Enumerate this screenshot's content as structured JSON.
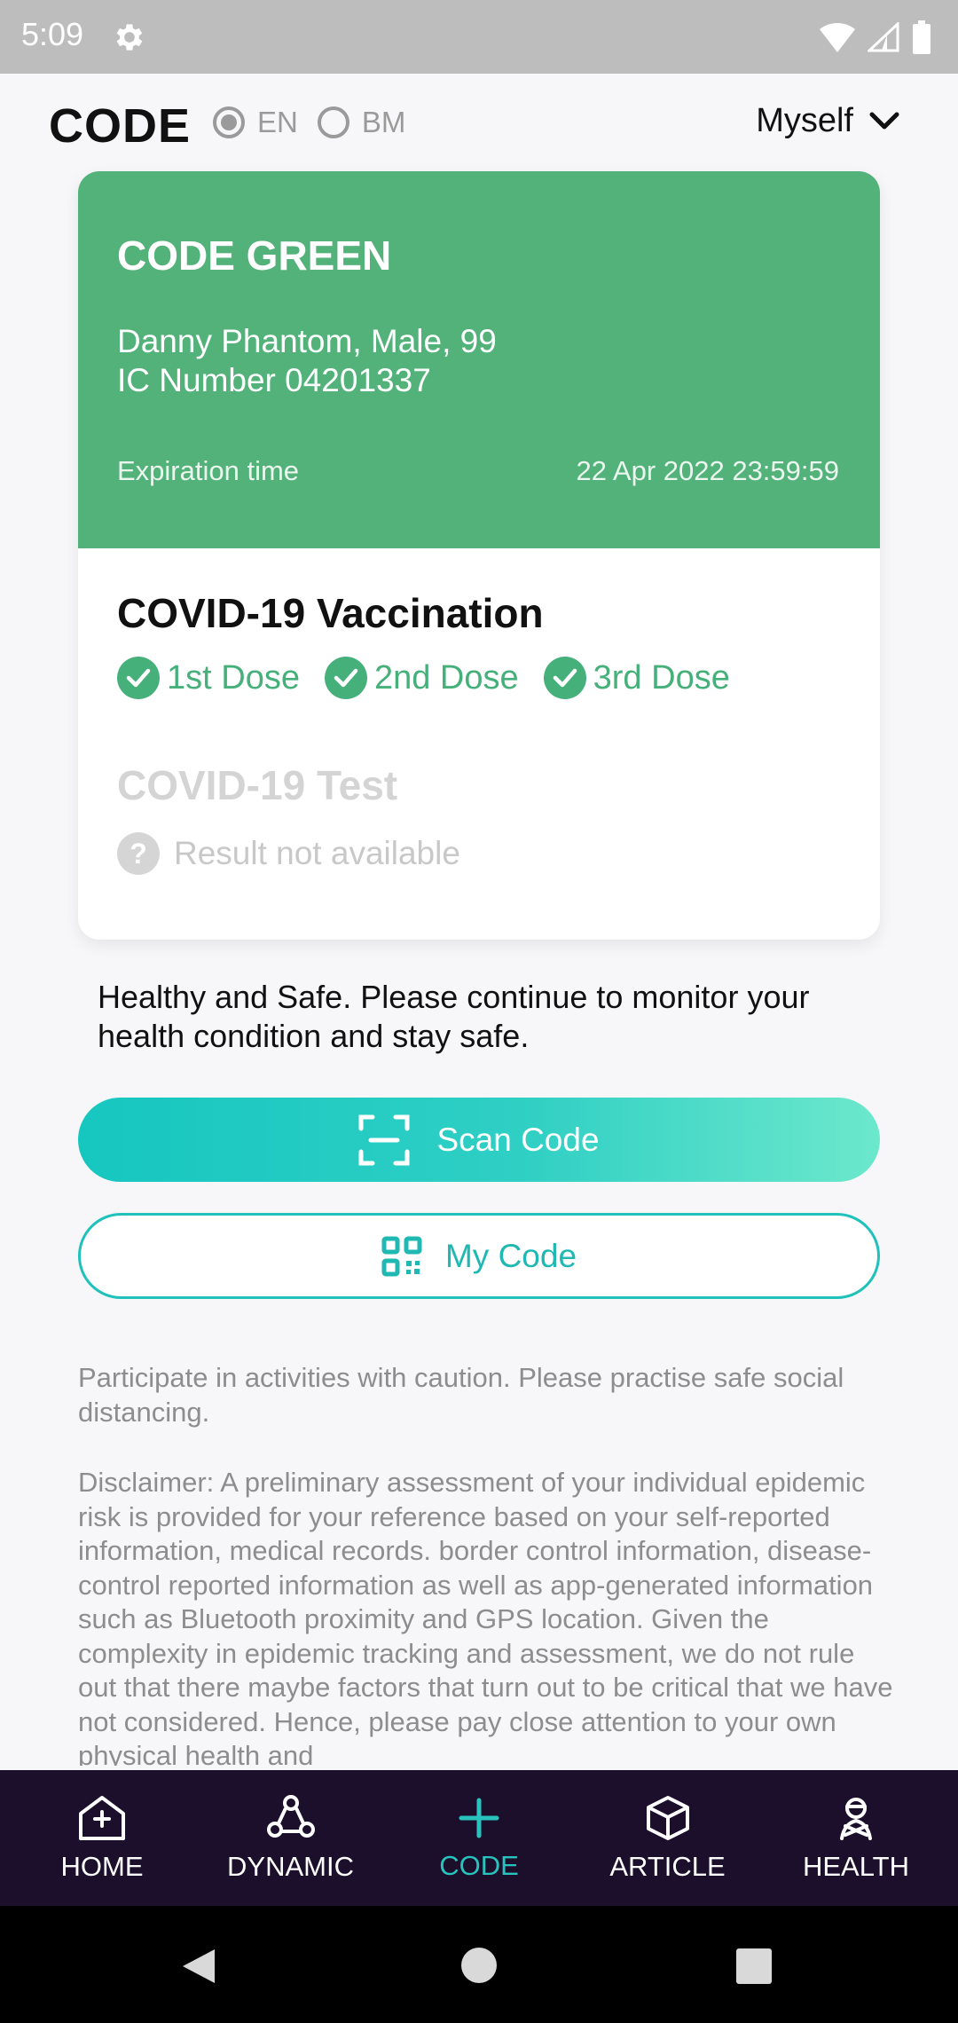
{
  "status_bar": {
    "time": "5:09"
  },
  "header": {
    "title": "CODE",
    "languages": [
      {
        "label": "EN",
        "selected": true
      },
      {
        "label": "BM",
        "selected": false
      }
    ],
    "profile": "Myself"
  },
  "card": {
    "status_title": "CODE GREEN",
    "person_line": "Danny Phantom, Male, 99",
    "ic_line": "IC Number 04201337",
    "expiration_label": "Expiration time",
    "expiration_value": "22 Apr 2022 23:59:59",
    "vaccination_title": "COVID-19 Vaccination",
    "doses": [
      "1st Dose",
      "2nd Dose",
      "3rd Dose"
    ],
    "test_title": "COVID-19 Test",
    "test_result": "Result not available",
    "status_color": "#52b27a"
  },
  "advice": "Healthy and Safe. Please continue to monitor your health condition and stay safe.",
  "buttons": {
    "scan": "Scan Code",
    "my_code": "My Code"
  },
  "participate": "Participate in activities with caution. Please practise safe social distancing.",
  "disclaimer": "Disclaimer: A preliminary assessment of your individual epidemic risk is provided for your reference based on your self-reported information, medical records. border control information, disease-control reported information as well as app-generated information such as Bluetooth proximity and GPS location. Given the complexity in epidemic tracking and assessment, we do not rule out that there maybe factors that turn out to be critical that we have not considered. Hence, please pay close attention to your own physical health and",
  "nav": {
    "items": [
      {
        "label": "HOME",
        "icon": "home-plus-icon"
      },
      {
        "label": "DYNAMIC",
        "icon": "dynamic-icon"
      },
      {
        "label": "CODE",
        "icon": "plus-icon",
        "active": true
      },
      {
        "label": "ARTICLE",
        "icon": "cube-icon"
      },
      {
        "label": "HEALTH",
        "icon": "health-icon"
      }
    ],
    "active_color": "#27c3bc",
    "background": "#1b0f2c"
  },
  "accent": "#1fc1ba"
}
